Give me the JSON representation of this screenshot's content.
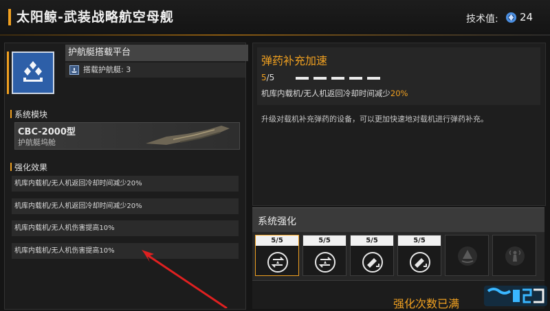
{
  "header": {
    "title": "太阳鲸-武装战略航空母舰",
    "tech_label": "技术值:",
    "tech_value": "24"
  },
  "platform": {
    "name": "护航艇搭载平台",
    "icon": "ship-platform-icon",
    "capacity_text": "搭载护航艇: 3"
  },
  "module": {
    "section_label": "系统模块",
    "name": "CBC-2000型",
    "subtitle": "护航艇坞舱"
  },
  "effects": {
    "section_label": "强化效果",
    "items": [
      "机库内载机/无人机返回冷却时间减少20%",
      "机库内载机/无人机返回冷却时间减少20%",
      "机库内载机/无人机伤害提高10%",
      "机库内载机/无人机伤害提高10%"
    ]
  },
  "detail": {
    "name": "弹药补充加速",
    "level": "5",
    "max": "/5",
    "level_fraction": 1.0,
    "desc_prefix": "机库内载机/无人机返回冷却时间减少",
    "desc_value": "20%",
    "long_desc": "升级对载机补充弹药的设备，可以更加快速地对载机进行弹药补充。"
  },
  "upgrade": {
    "title": "系统强化",
    "slots": [
      {
        "count": "5/5",
        "icon": "drone-reload-icon",
        "selected": true
      },
      {
        "count": "5/5",
        "icon": "drone-reload-icon",
        "selected": false
      },
      {
        "count": "5/5",
        "icon": "drone-damage-icon",
        "selected": false
      },
      {
        "count": "5/5",
        "icon": "drone-damage-icon",
        "selected": false
      },
      {
        "count": "",
        "icon": "locked-cone-icon",
        "selected": false
      },
      {
        "count": "",
        "icon": "locked-beacon-icon",
        "selected": false
      }
    ],
    "footer_text": "强化次数已满"
  },
  "colors": {
    "accent": "#f0a020",
    "tile_blue": "#2d5fa8",
    "annotation_arrow": "#e02020"
  }
}
